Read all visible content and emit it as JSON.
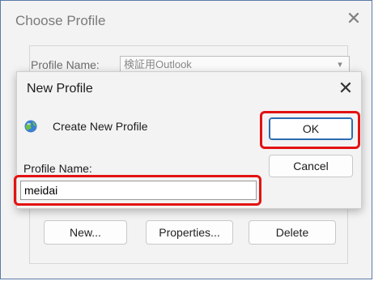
{
  "background_dialog": {
    "title": "Choose Profile",
    "close_icon": "close-icon",
    "profile_name_label": "Profile Name:",
    "profile_value": "検証用Outlook",
    "buttons": {
      "new": "New...",
      "properties": "Properties...",
      "delete": "Delete"
    }
  },
  "new_profile_dialog": {
    "title": "New Profile",
    "close_icon": "close-icon",
    "create_text": "Create New Profile",
    "profile_name_label": "Profile Name:",
    "profile_name_value": "meidai",
    "ok_label": "OK",
    "cancel_label": "Cancel"
  },
  "colors": {
    "highlight": "#e31212",
    "default_button_border": "#2b6cb0"
  }
}
